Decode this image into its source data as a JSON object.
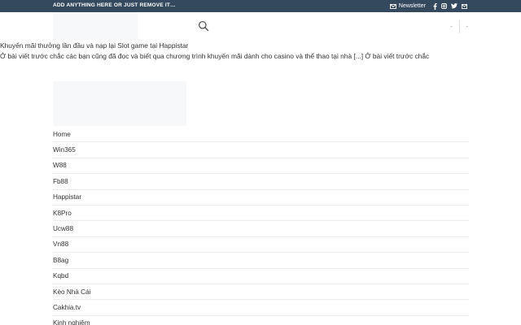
{
  "topbar": {
    "text": "ADD ANYTHING HERE OR JUST REMOVE IT…",
    "newsletter_label": "Newsletter",
    "social_icons": [
      "facebook-icon",
      "instagram-icon",
      "twitter-icon",
      "email-icon"
    ]
  },
  "header": {
    "right_item_1": "-",
    "right_item_2": "-"
  },
  "post": {
    "title": "Khuyến mãi thưởng lần đầu và nạp lại Slot game tại Happistar",
    "excerpt": "Ở bài viết trước chắc các bạn cũng đã đọc và biết qua chương trình khuyến mãi dành cho casino và thể thao tại nhà [...] Ở bài viết trước chắc"
  },
  "menu": {
    "items": [
      {
        "label": "Home"
      },
      {
        "label": "Win365"
      },
      {
        "label": "W88"
      },
      {
        "label": "Fb88"
      },
      {
        "label": "Happistar"
      },
      {
        "label": "K8Pro"
      },
      {
        "label": "Ucw88"
      },
      {
        "label": "Vn88"
      },
      {
        "label": "B8ag"
      },
      {
        "label": "Kqbd"
      },
      {
        "label": "Kèo Nhà Cái"
      },
      {
        "label": "Cakhia.tv"
      },
      {
        "label": "Kinh nghiệm"
      }
    ]
  },
  "colors": {
    "topbar_bg": "#34495e",
    "placeholder_bg": "#f7f8f9",
    "divider": "#ececec"
  }
}
